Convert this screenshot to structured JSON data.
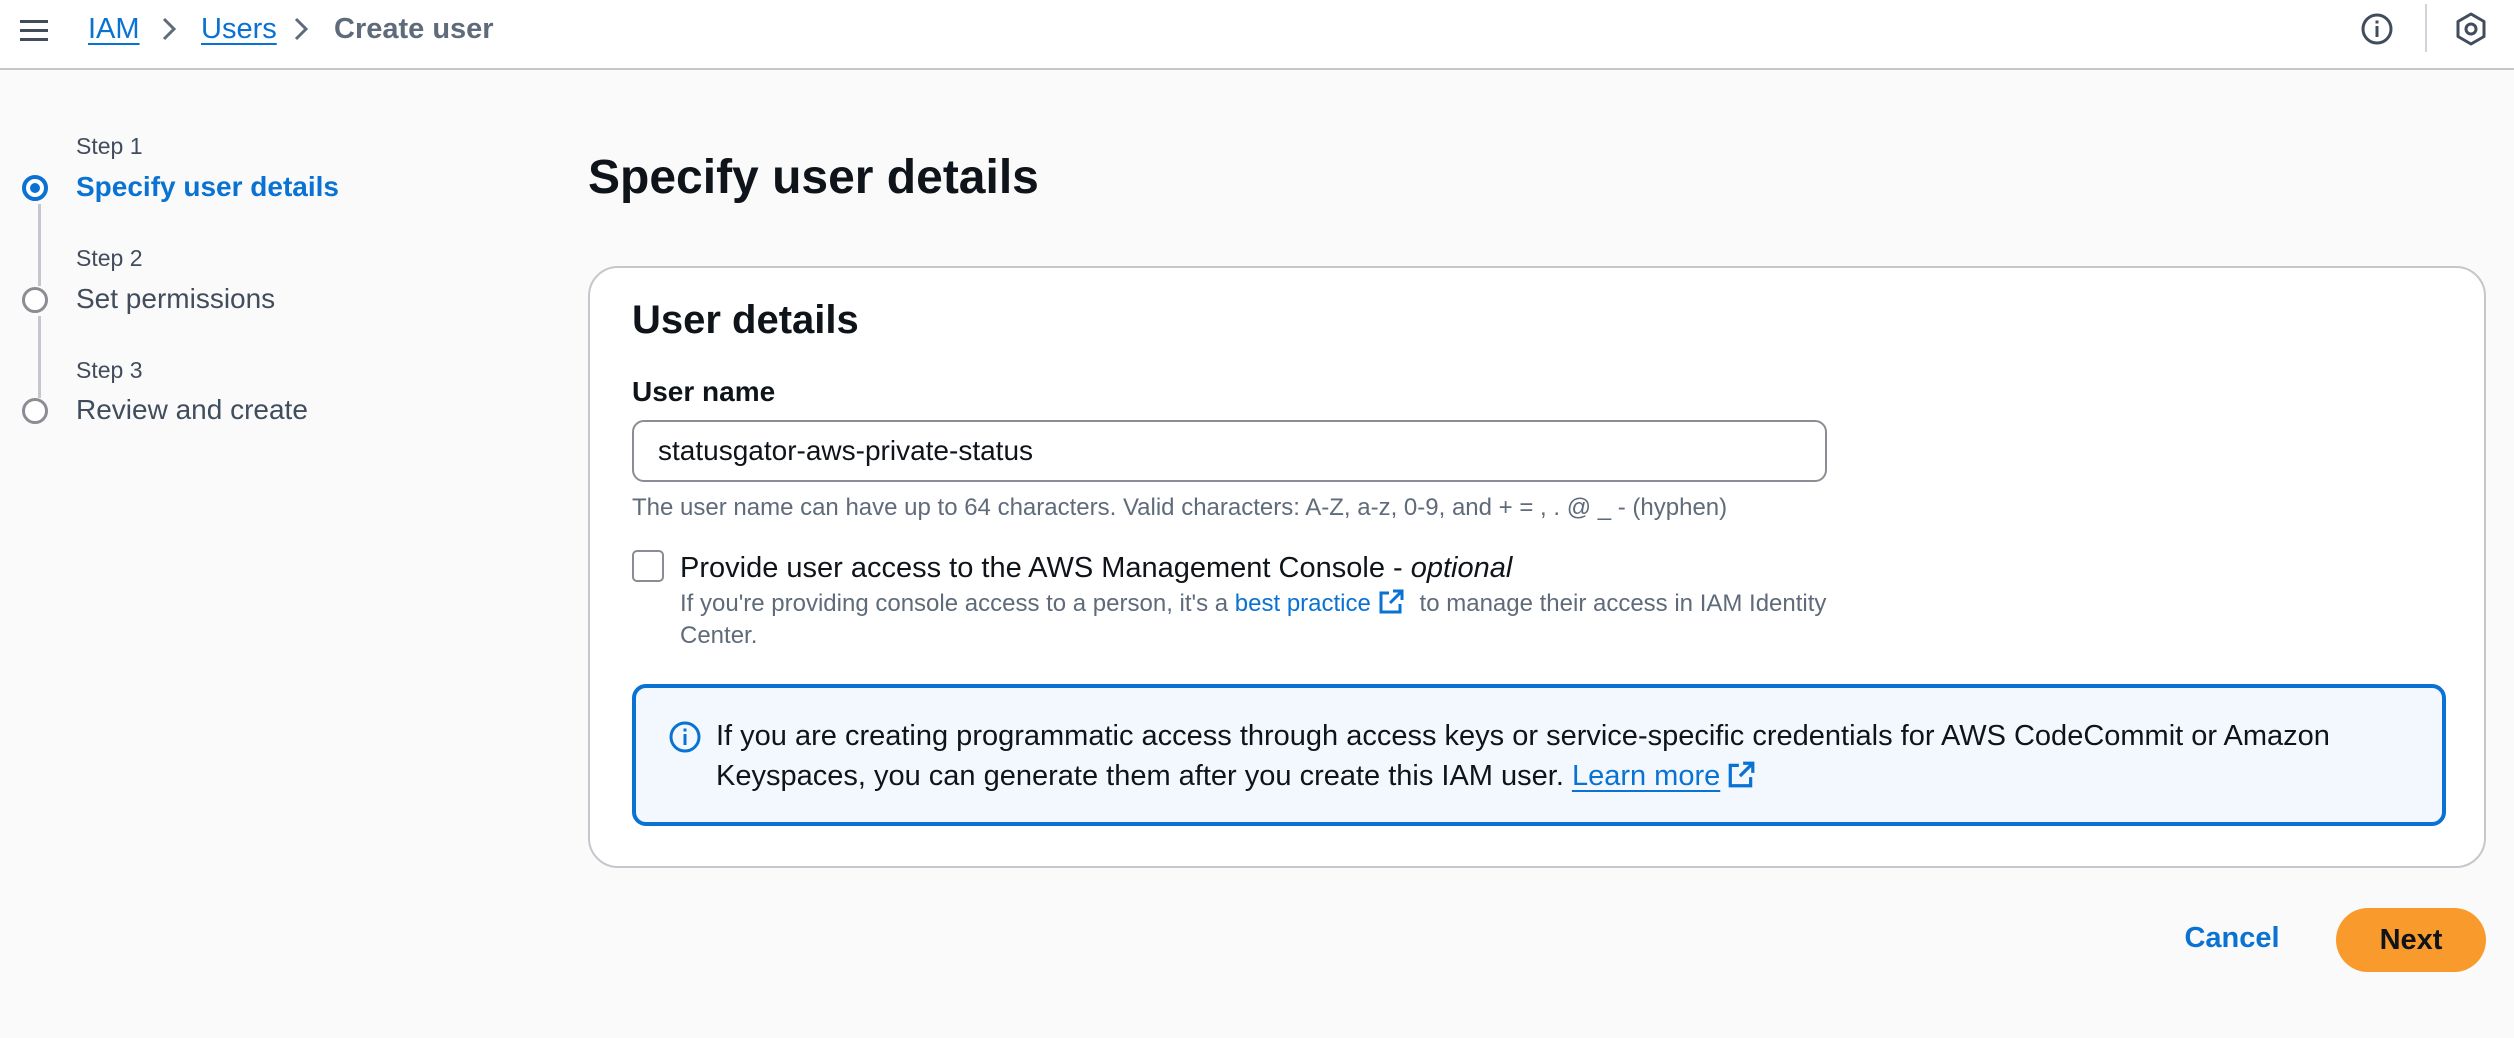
{
  "breadcrumb": {
    "items": [
      {
        "label": "IAM"
      },
      {
        "label": "Users"
      },
      {
        "label": "Create user"
      }
    ]
  },
  "icons": {
    "menu": "hamburger-menu-icon",
    "info": "info-circle-icon",
    "settings": "settings-hexagon-icon",
    "external": "external-link-icon"
  },
  "stepper": {
    "steps": [
      {
        "step_label": "Step 1",
        "title": "Specify user details",
        "active": true
      },
      {
        "step_label": "Step 2",
        "title": "Set permissions",
        "active": false
      },
      {
        "step_label": "Step 3",
        "title": "Review and create",
        "active": false
      }
    ]
  },
  "main": {
    "page_title": "Specify user details",
    "card": {
      "title": "User details",
      "username": {
        "label": "User name",
        "value": "statusgator-aws-private-status",
        "constraint": "The user name can have up to 64 characters. Valid characters: A-Z, a-z, 0-9, and + = , . @ _ - (hyphen)"
      },
      "console_access": {
        "label": "Provide user access to the AWS Management Console - ",
        "optional": "optional",
        "checked": false,
        "description_before": "If you're providing console access to a person, it's a ",
        "link": "best practice",
        "description_after": " to manage their access in IAM Identity Center."
      },
      "alert": {
        "text": "If you are creating programmatic access through access keys or service-specific credentials for AWS CodeCommit or Amazon Keyspaces, you can generate them after you create this IAM user. ",
        "link": "Learn more"
      }
    }
  },
  "actions": {
    "cancel": "Cancel",
    "next": "Next"
  },
  "colors": {
    "link_blue": "#0972d3",
    "primary_button": "#f89b2c",
    "alert_background": "#f2f8fd",
    "text_dark": "#0f141a",
    "text_secondary": "#5f6b7a",
    "border": "#c6c6cd"
  }
}
